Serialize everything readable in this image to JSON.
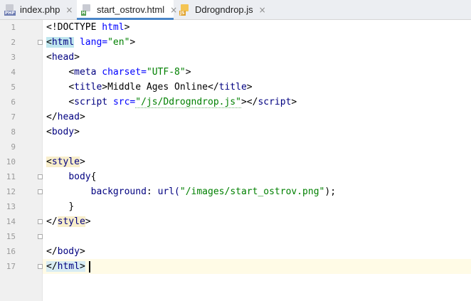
{
  "tabs": [
    {
      "label": "index.php",
      "icon": "php-file-icon",
      "badge": "PHP",
      "active": false
    },
    {
      "label": "start_ostrov.html",
      "icon": "html-file-icon",
      "badge": "H",
      "active": true
    },
    {
      "label": "Ddrogndrop.js",
      "icon": "js-file-icon",
      "badge": "JS",
      "active": false
    }
  ],
  "tab_close_glyph": "×",
  "line_numbers": [
    "1",
    "2",
    "3",
    "4",
    "5",
    "6",
    "7",
    "8",
    "9",
    "10",
    "11",
    "12",
    "13",
    "14",
    "15",
    "16",
    "17"
  ],
  "code": {
    "l1": {
      "a": "<!DOCTYPE ",
      "b": "html",
      "c": ">"
    },
    "l2": {
      "a": "<",
      "tag": "html",
      "sp": " ",
      "attr": "lang",
      "eq": "=",
      "val": "\"en\"",
      "end": ">"
    },
    "l3": {
      "a": "<",
      "tag": "head",
      "end": ">"
    },
    "l4": {
      "indent": "    ",
      "a": "<",
      "tag": "meta",
      "sp": " ",
      "attr": "charset",
      "eq": "=",
      "val": "\"UTF-8\"",
      "end": ">"
    },
    "l5": {
      "indent": "    ",
      "a": "<",
      "tag": "title",
      "m": ">",
      "text": "Middle Ages Online",
      "c": "</",
      "tag2": "title",
      "end": ">"
    },
    "l6": {
      "indent": "    ",
      "a": "<",
      "tag": "script",
      "sp": " ",
      "attr": "src",
      "eq": "=",
      "val": "\"/js/Ddrogndrop.js\"",
      "m": "></",
      "tag2": "script",
      "end": ">"
    },
    "l7": {
      "a": "</",
      "tag": "head",
      "end": ">"
    },
    "l8": {
      "a": "<",
      "tag": "body",
      "end": ">"
    },
    "l10": {
      "a": "<",
      "tag": "style",
      "end": ">"
    },
    "l11": {
      "indent": "    ",
      "sel": "body",
      "brace": "{"
    },
    "l12": {
      "indent": "        ",
      "prop": "background",
      "colon": ": ",
      "fn": "url(",
      "val": "\"/images/start_ostrov.png\"",
      "end": ");"
    },
    "l13": {
      "indent": "    ",
      "brace": "}"
    },
    "l14": {
      "a": "</",
      "tag": "style",
      "end": ">"
    },
    "l16": {
      "a": "</",
      "tag": "body",
      "end": ">"
    },
    "l17": {
      "a": "</",
      "tag": "html",
      "end": ">"
    }
  },
  "current_line": "17",
  "colors": {
    "tag": "#000080",
    "attribute": "#0000ff",
    "string": "#008000",
    "active_tab_underline": "#4a86c8",
    "current_line_bg": "#fffbe6"
  }
}
